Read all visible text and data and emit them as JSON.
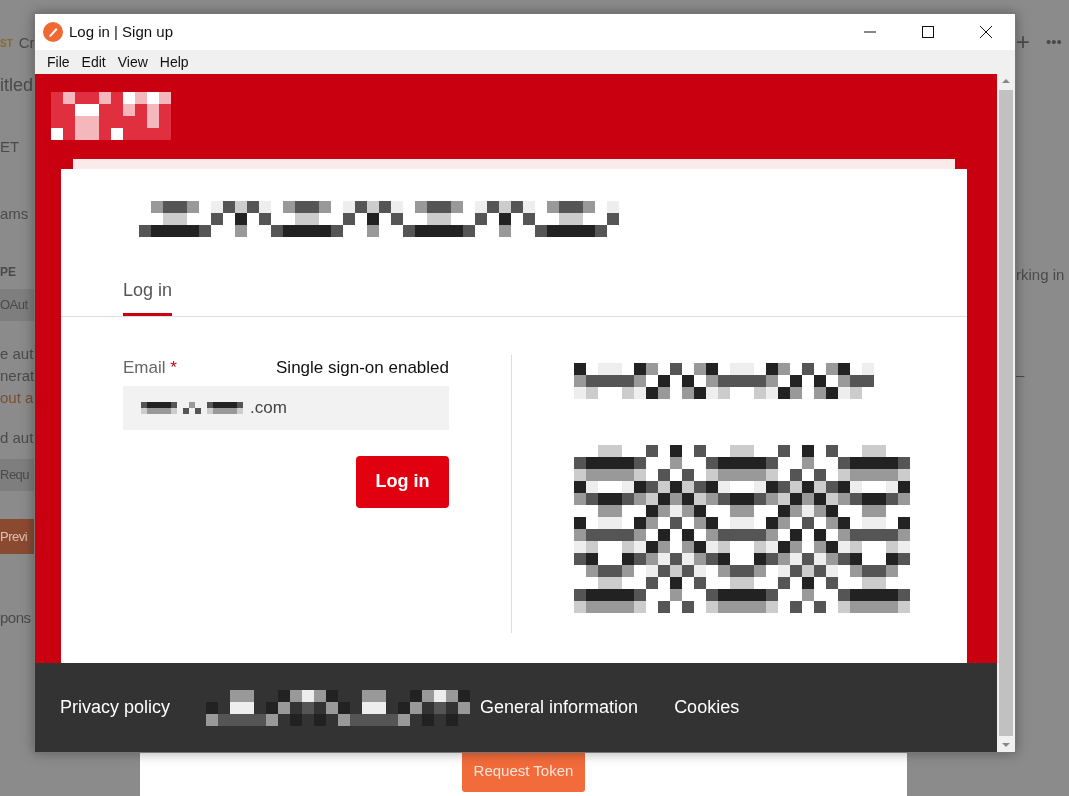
{
  "background_app": {
    "left_fragments": [
      {
        "kind": "tag",
        "text": "ST",
        "extra": "Cr"
      },
      {
        "kind": "title",
        "text": "itled"
      },
      {
        "kind": "plain",
        "text": "ET"
      },
      {
        "kind": "plain",
        "text": "ams"
      },
      {
        "kind": "heading",
        "text": "PE"
      },
      {
        "kind": "select",
        "text": "OAut"
      },
      {
        "kind": "plain",
        "text": "e aut"
      },
      {
        "kind": "plain",
        "text": "nerat"
      },
      {
        "kind": "accent",
        "text": "out a"
      },
      {
        "kind": "plain",
        "text": "d aut"
      },
      {
        "kind": "select",
        "text": "Requ"
      },
      {
        "kind": "button",
        "text": "Previ"
      },
      {
        "kind": "faint",
        "text": "pons"
      }
    ],
    "right_fragments": [
      {
        "kind": "toolbar",
        "text": "+",
        "extra": "•••"
      },
      {
        "kind": "plain",
        "text": "rking in"
      },
      {
        "kind": "plain",
        "text": "–"
      }
    ],
    "bottom_button": "Request Token"
  },
  "window": {
    "title": "Log in | Sign up",
    "menu": [
      "File",
      "Edit",
      "View",
      "Help"
    ]
  },
  "login": {
    "tabs": [
      {
        "label": "Log in",
        "selected": true
      }
    ],
    "email": {
      "label": "Email",
      "required_mark": "*",
      "value": ".com"
    },
    "sso_note": "Single sign-on enabled",
    "submit": "Log in"
  },
  "footer": {
    "links": [
      "Privacy policy",
      "General information",
      "Cookies"
    ]
  }
}
